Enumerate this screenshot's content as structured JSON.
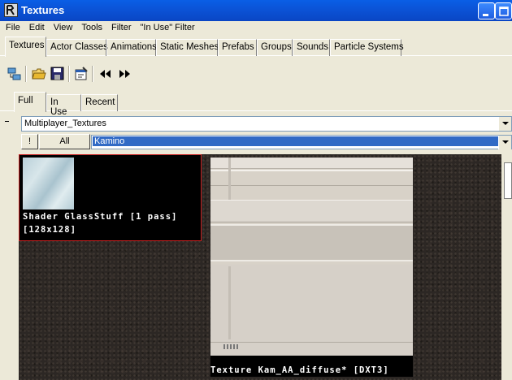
{
  "window": {
    "title": "Textures"
  },
  "menu": [
    "File",
    "Edit",
    "View",
    "Tools",
    "Filter",
    "\"In Use\" Filter"
  ],
  "tabs": [
    "Textures",
    "Actor Classes",
    "Animations",
    "Static Meshes",
    "Prefabs",
    "Groups",
    "Sounds",
    "Particle Systems"
  ],
  "active_tab": "Textures",
  "toolbar": {
    "icons": [
      "browser-sync-icon",
      "open-folder-icon",
      "save-icon",
      "properties-icon",
      "previous-icon",
      "next-icon"
    ]
  },
  "subtabs": [
    "Full",
    "In Use",
    "Recent"
  ],
  "active_subtab": "Full",
  "package_combo": {
    "value": "Multiplayer_Textures"
  },
  "filter": {
    "exclaim_label": "!",
    "all_label": "All",
    "group_value": "Kamino"
  },
  "textures": [
    {
      "label": "Shader GlassStuff [1 pass]",
      "size": "[128x128]"
    },
    {
      "label": "Texture Kam_AA_diffuse* [DXT3]"
    }
  ],
  "colors": {
    "selection": "#316ac5",
    "title_bar": "#0b54d8",
    "selected_border": "#c82020"
  }
}
